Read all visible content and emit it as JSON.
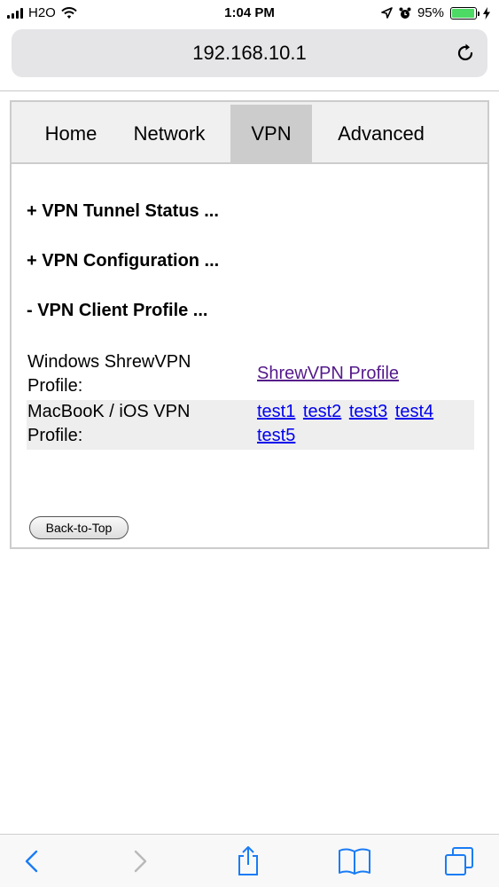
{
  "status_bar": {
    "carrier": "H2O",
    "time": "1:04 PM",
    "battery_percent": "95%",
    "battery_level": 0.95
  },
  "address_bar": {
    "url": "192.168.10.1"
  },
  "nav": {
    "tabs": [
      {
        "label": "Home"
      },
      {
        "label": "Network"
      },
      {
        "label": "VPN",
        "active": true
      },
      {
        "label": "Advanced"
      }
    ]
  },
  "sections": {
    "tunnel_status": "+ VPN Tunnel Status ...",
    "configuration": "+ VPN Configuration ...",
    "client_profile": "- VPN Client Profile ..."
  },
  "profiles": {
    "windows": {
      "label_line1": "Windows ShrewVPN",
      "label_line2": "Profile:",
      "link": "ShrewVPN Profile"
    },
    "macbook": {
      "label_line1": "MacBooK / iOS VPN",
      "label_line2": "Profile:",
      "links": [
        "test1",
        "test2",
        "test3",
        "test4",
        "test5"
      ]
    }
  },
  "back_to_top": "Back-to-Top",
  "colors": {
    "link": "#0000ee",
    "visited_link": "#551a8b",
    "ios_blue": "#1a7cf5",
    "battery_green": "#4cd964"
  },
  "icons": {
    "signal": "cellular-signal-icon",
    "wifi": "wifi-icon",
    "location": "location-arrow-icon",
    "alarm": "alarm-clock-icon",
    "battery": "battery-icon",
    "charging": "charging-bolt-icon",
    "reload": "reload-icon",
    "back": "chevron-left-icon",
    "forward": "chevron-right-icon",
    "share": "share-icon",
    "bookmarks": "book-icon",
    "tabs": "tabs-icon"
  }
}
